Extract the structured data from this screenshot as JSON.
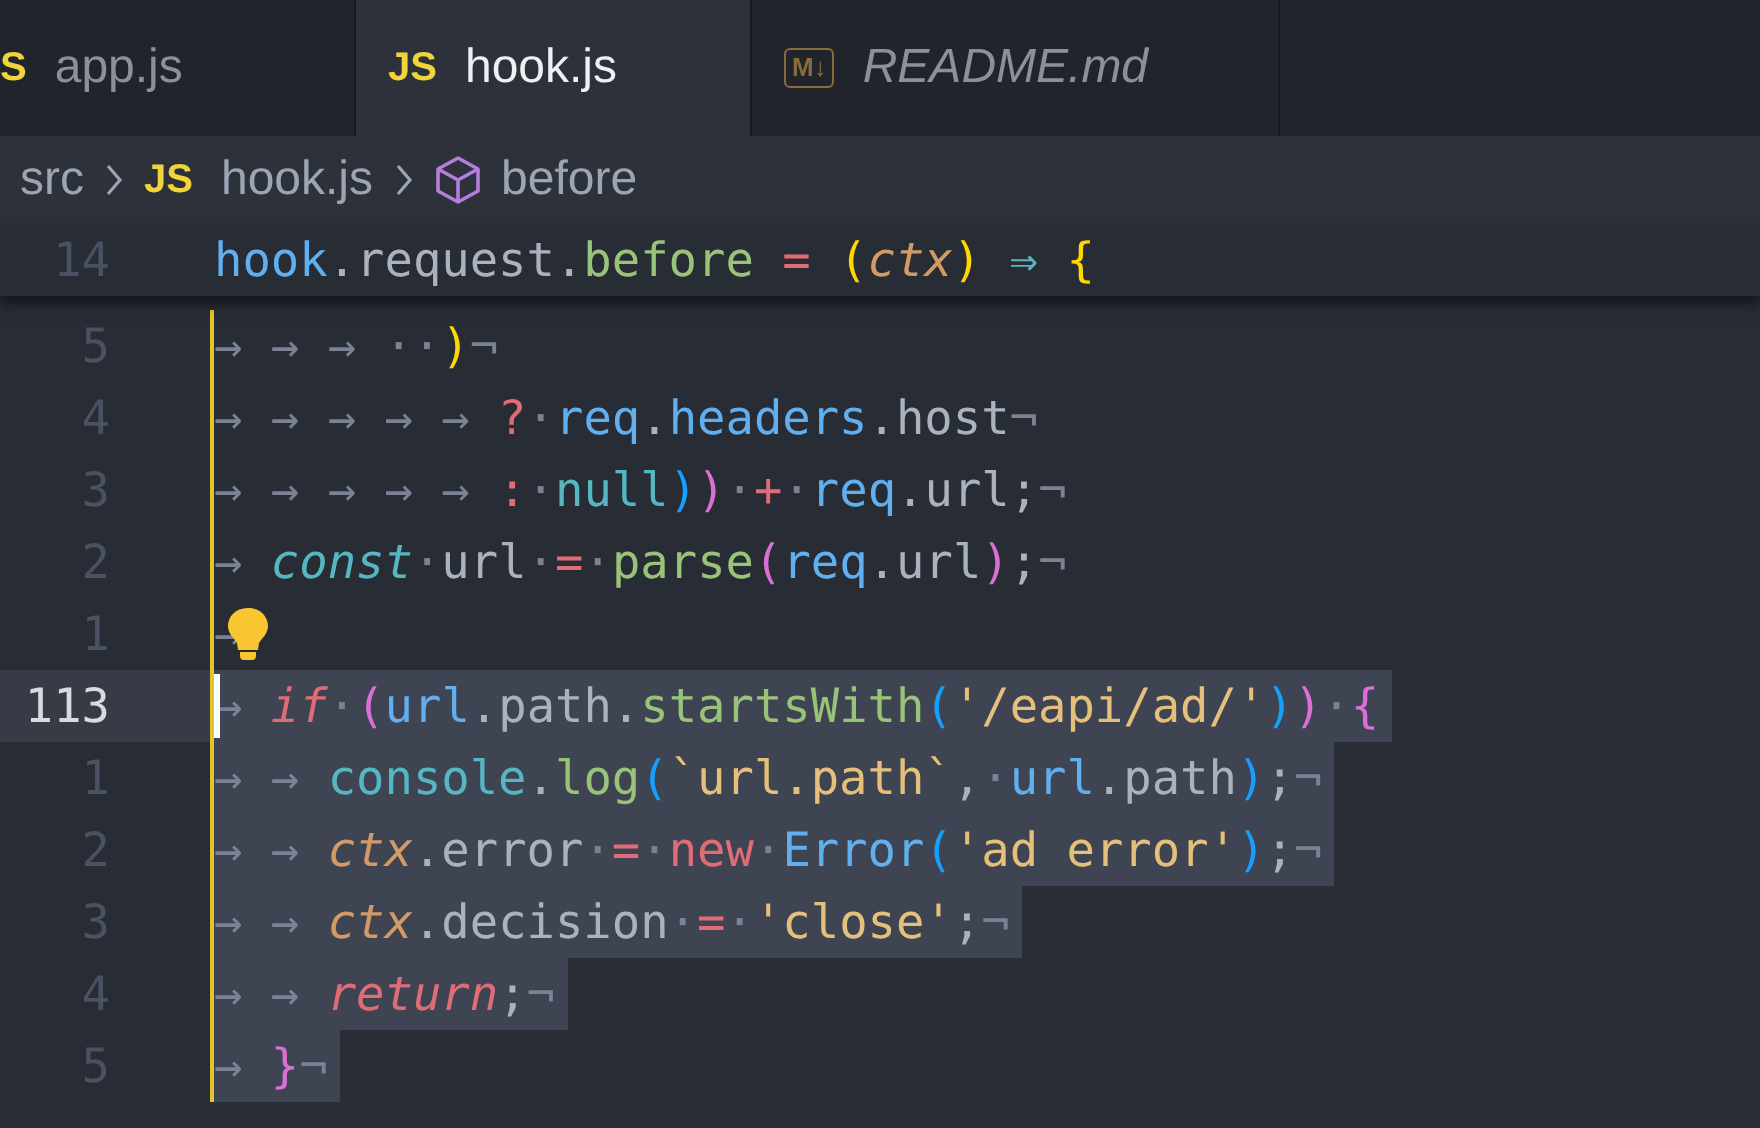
{
  "tabs": [
    {
      "kind": "js",
      "badge": "S",
      "label": "app.js",
      "selected": false,
      "preview": false
    },
    {
      "kind": "js",
      "badge": "JS",
      "label": "hook.js",
      "selected": true,
      "preview": false
    },
    {
      "kind": "md",
      "badge": "M↓",
      "label": "README.md",
      "selected": false,
      "preview": true
    }
  ],
  "breadcrumb": [
    {
      "kind": "folder",
      "label": "src"
    },
    {
      "kind": "file",
      "badge": "JS",
      "label": "hook.js"
    },
    {
      "kind": "symbol",
      "label": "before"
    }
  ],
  "sticky_line": {
    "number": "14",
    "tokens": [
      {
        "text": "hook",
        "kind": "var"
      },
      {
        "text": ".request.",
        "kind": "plain"
      },
      {
        "text": "before",
        "kind": "fn"
      },
      {
        "text": " = ",
        "kind": "op"
      },
      {
        "text": "(",
        "kind": "b1"
      },
      {
        "text": "ctx",
        "kind": "param"
      },
      {
        "text": ")",
        "kind": "b1"
      },
      {
        "text": " ⇒ ",
        "kind": "builtin"
      },
      {
        "text": "{",
        "kind": "b1"
      }
    ]
  },
  "lines": [
    {
      "number": "5",
      "current": false,
      "selected": false,
      "hint_icon": false,
      "tokens": [
        {
          "text": "→ → → ··",
          "kind": "ws"
        },
        {
          "text": ")",
          "kind": "b1"
        },
        {
          "text": "¬",
          "kind": "ws"
        }
      ]
    },
    {
      "number": "4",
      "current": false,
      "selected": false,
      "hint_icon": false,
      "tokens": [
        {
          "text": "→ → → → → ",
          "kind": "ws"
        },
        {
          "text": "?",
          "kind": "op"
        },
        {
          "text": "·",
          "kind": "ws"
        },
        {
          "text": "req",
          "kind": "var"
        },
        {
          "text": ".",
          "kind": "plain"
        },
        {
          "text": "headers",
          "kind": "var"
        },
        {
          "text": ".host",
          "kind": "plain"
        },
        {
          "text": "¬",
          "kind": "ws"
        }
      ]
    },
    {
      "number": "3",
      "current": false,
      "selected": false,
      "hint_icon": false,
      "tokens": [
        {
          "text": "→ → → → → ",
          "kind": "ws"
        },
        {
          "text": ":",
          "kind": "op"
        },
        {
          "text": "·",
          "kind": "ws"
        },
        {
          "text": "null",
          "kind": "builtin"
        },
        {
          "text": ")",
          "kind": "b3"
        },
        {
          "text": ")",
          "kind": "b2"
        },
        {
          "text": "·",
          "kind": "ws"
        },
        {
          "text": "+",
          "kind": "op"
        },
        {
          "text": "·",
          "kind": "ws"
        },
        {
          "text": "req",
          "kind": "var"
        },
        {
          "text": ".url;",
          "kind": "plain"
        },
        {
          "text": "¬",
          "kind": "ws"
        }
      ]
    },
    {
      "number": "2",
      "current": false,
      "selected": false,
      "hint_icon": false,
      "tokens": [
        {
          "text": "→ ",
          "kind": "ws"
        },
        {
          "text": "const",
          "kind": "storage"
        },
        {
          "text": "·",
          "kind": "ws"
        },
        {
          "text": "url",
          "kind": "plain"
        },
        {
          "text": "·",
          "kind": "ws"
        },
        {
          "text": "=",
          "kind": "op"
        },
        {
          "text": "·",
          "kind": "ws"
        },
        {
          "text": "parse",
          "kind": "fn"
        },
        {
          "text": "(",
          "kind": "b2"
        },
        {
          "text": "req",
          "kind": "var"
        },
        {
          "text": ".url",
          "kind": "plain"
        },
        {
          "text": ")",
          "kind": "b2"
        },
        {
          "text": ";",
          "kind": "plain"
        },
        {
          "text": "¬",
          "kind": "ws"
        }
      ]
    },
    {
      "number": "1",
      "current": false,
      "selected": false,
      "hint_icon": true,
      "tokens": [
        {
          "text": "→ ",
          "kind": "ws"
        }
      ]
    },
    {
      "number": "113",
      "current": true,
      "selected": true,
      "hint_icon": false,
      "tokens": [
        {
          "text": "→ ",
          "kind": "ws"
        },
        {
          "text": "if",
          "kind": "keyword"
        },
        {
          "text": "·",
          "kind": "ws"
        },
        {
          "text": "(",
          "kind": "b2"
        },
        {
          "text": "url",
          "kind": "var"
        },
        {
          "text": ".path.",
          "kind": "plain"
        },
        {
          "text": "startsWith",
          "kind": "fn"
        },
        {
          "text": "(",
          "kind": "b3"
        },
        {
          "text": "'/eapi/ad/'",
          "kind": "string"
        },
        {
          "text": ")",
          "kind": "b3"
        },
        {
          "text": ")",
          "kind": "b2"
        },
        {
          "text": "·",
          "kind": "ws"
        },
        {
          "text": "{",
          "kind": "b2"
        }
      ]
    },
    {
      "number": "1",
      "current": false,
      "selected": true,
      "hint_icon": false,
      "tokens": [
        {
          "text": "→ → ",
          "kind": "ws"
        },
        {
          "text": "console",
          "kind": "builtin"
        },
        {
          "text": ".",
          "kind": "plain"
        },
        {
          "text": "log",
          "kind": "fn"
        },
        {
          "text": "(",
          "kind": "b3"
        },
        {
          "text": "`url.path`",
          "kind": "string"
        },
        {
          "text": ",",
          "kind": "plain"
        },
        {
          "text": "·",
          "kind": "ws"
        },
        {
          "text": "url",
          "kind": "var"
        },
        {
          "text": ".path",
          "kind": "plain"
        },
        {
          "text": ")",
          "kind": "b3"
        },
        {
          "text": ";",
          "kind": "plain"
        },
        {
          "text": "¬",
          "kind": "ws"
        }
      ]
    },
    {
      "number": "2",
      "current": false,
      "selected": true,
      "hint_icon": false,
      "tokens": [
        {
          "text": "→ → ",
          "kind": "ws"
        },
        {
          "text": "ctx",
          "kind": "param"
        },
        {
          "text": ".error",
          "kind": "plain"
        },
        {
          "text": "·",
          "kind": "ws"
        },
        {
          "text": "=",
          "kind": "op"
        },
        {
          "text": "·",
          "kind": "ws"
        },
        {
          "text": "new",
          "kind": "op"
        },
        {
          "text": "·",
          "kind": "ws"
        },
        {
          "text": "Error",
          "kind": "var"
        },
        {
          "text": "(",
          "kind": "b3"
        },
        {
          "text": "'ad error'",
          "kind": "string"
        },
        {
          "text": ")",
          "kind": "b3"
        },
        {
          "text": ";",
          "kind": "plain"
        },
        {
          "text": "¬",
          "kind": "ws"
        }
      ]
    },
    {
      "number": "3",
      "current": false,
      "selected": true,
      "hint_icon": false,
      "tokens": [
        {
          "text": "→ → ",
          "kind": "ws"
        },
        {
          "text": "ctx",
          "kind": "param"
        },
        {
          "text": ".decision",
          "kind": "plain"
        },
        {
          "text": "·",
          "kind": "ws"
        },
        {
          "text": "=",
          "kind": "op"
        },
        {
          "text": "·",
          "kind": "ws"
        },
        {
          "text": "'close'",
          "kind": "string"
        },
        {
          "text": ";",
          "kind": "plain"
        },
        {
          "text": "¬",
          "kind": "ws"
        }
      ]
    },
    {
      "number": "4",
      "current": false,
      "selected": true,
      "hint_icon": false,
      "tokens": [
        {
          "text": "→ → ",
          "kind": "ws"
        },
        {
          "text": "return",
          "kind": "keyword"
        },
        {
          "text": ";",
          "kind": "plain"
        },
        {
          "text": "¬",
          "kind": "ws"
        }
      ]
    },
    {
      "number": "5",
      "current": false,
      "selected": true,
      "hint_icon": false,
      "tokens": [
        {
          "text": "→ ",
          "kind": "ws"
        },
        {
          "text": "}",
          "kind": "b2"
        },
        {
          "text": "¬",
          "kind": "ws"
        }
      ]
    }
  ]
}
